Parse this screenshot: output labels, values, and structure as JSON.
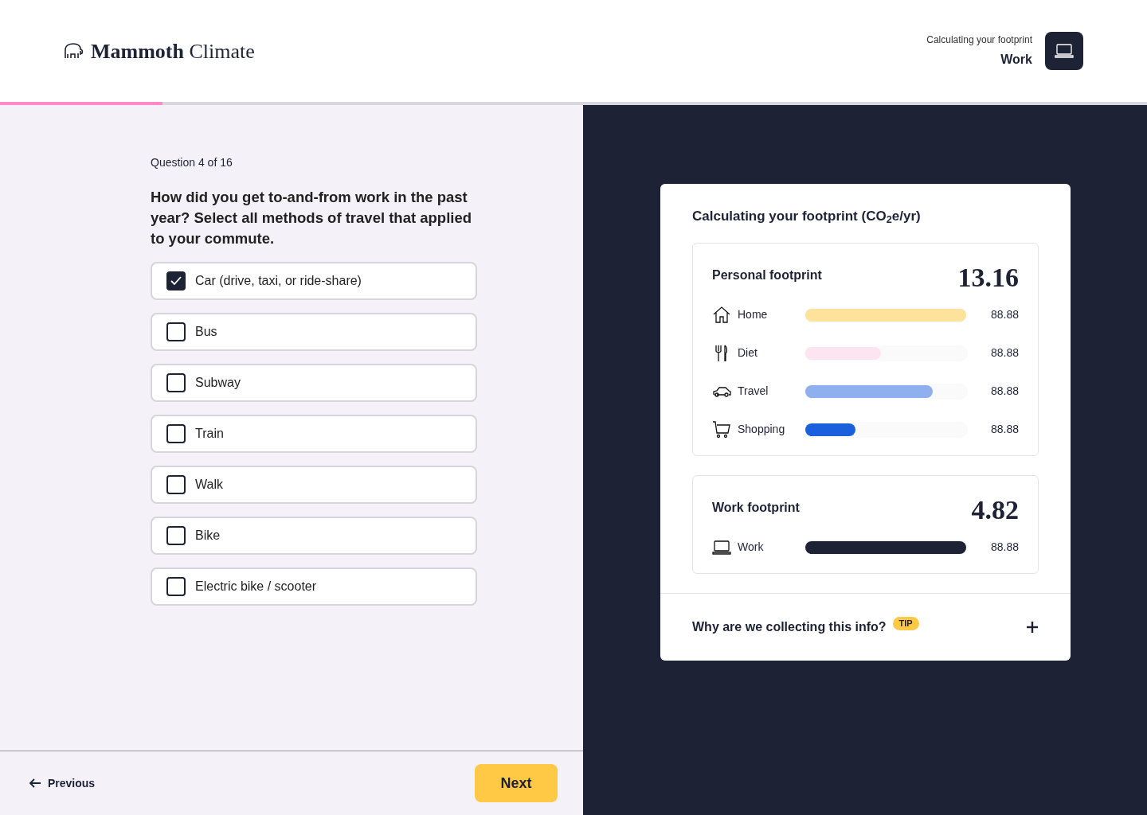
{
  "header": {
    "brand_bold": "Mammoth",
    "brand_light": "Climate",
    "context_label": "Calculating your footprint",
    "context_value": "Work"
  },
  "progress": {
    "level": 0.142
  },
  "question": {
    "counter": "Question 4 of 16",
    "text": "How did you get to-and-from work in the past year? Select all methods of travel that applied to your commute.",
    "options": [
      {
        "label": "Car (drive, taxi, or ride-share)",
        "checked": true
      },
      {
        "label": "Bus",
        "checked": false
      },
      {
        "label": "Subway",
        "checked": false
      },
      {
        "label": "Train",
        "checked": false
      },
      {
        "label": "Walk",
        "checked": false
      },
      {
        "label": "Bike",
        "checked": false
      },
      {
        "label": "Electric bike / scooter",
        "checked": false
      }
    ]
  },
  "footer": {
    "previous": "Previous",
    "next": "Next"
  },
  "summary": {
    "title": "Calculating your footprint (CO$_{2}$e/yr)",
    "sections": [
      {
        "title": "Personal footprint",
        "total": "13.16",
        "items": [
          {
            "kind": "home",
            "label": "Home",
            "level": 1.0,
            "color": "#fde29b",
            "value": "88.88"
          },
          {
            "kind": "diet",
            "label": "Diet",
            "level": 0.47,
            "color": "#fde4f1",
            "value": "88.88"
          },
          {
            "kind": "travel",
            "label": "Travel",
            "level": 0.79,
            "color": "#8eb0ee",
            "value": "88.88"
          },
          {
            "kind": "shopping",
            "label": "Shopping",
            "level": 0.31,
            "color": "#1a5fdc",
            "value": "88.88"
          }
        ]
      },
      {
        "title": "Work footprint",
        "total": "4.82",
        "items": [
          {
            "kind": "work",
            "label": "Work",
            "level": 1.0,
            "color": "#1e2235",
            "value": "88.88"
          }
        ]
      }
    ],
    "info": {
      "text": "Why are we collecting this info?",
      "badge": "TIP",
      "expanded": false
    }
  }
}
